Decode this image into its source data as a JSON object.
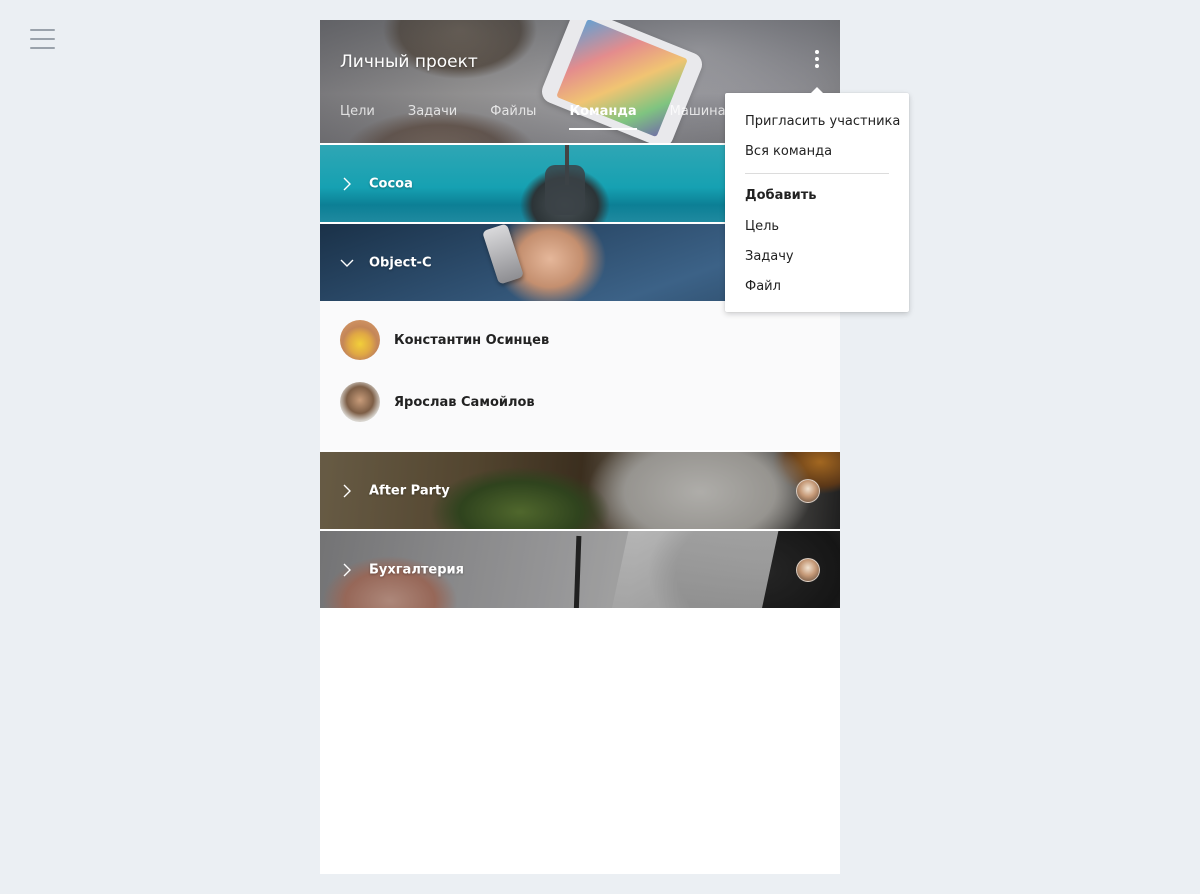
{
  "header": {
    "title": "Личный проект",
    "more_icon": "more-vertical-icon",
    "tabs": [
      {
        "label": "Цели",
        "active": false
      },
      {
        "label": "Задачи",
        "active": false
      },
      {
        "label": "Файлы",
        "active": false
      },
      {
        "label": "Команда",
        "active": true
      },
      {
        "label": "Машина времени",
        "active": false
      }
    ]
  },
  "nav": {
    "menu_icon": "hamburger-icon"
  },
  "teams": [
    {
      "name": "Cocoa",
      "expanded": false
    },
    {
      "name": "Object-C",
      "expanded": true
    },
    {
      "name": "After Party",
      "expanded": false
    },
    {
      "name": "Бухгалтерия",
      "expanded": false
    }
  ],
  "members": [
    {
      "name": "Константин Осинцев"
    },
    {
      "name": "Ярослав Самойлов"
    }
  ],
  "dropdown": {
    "items_top": [
      "Пригласить участника",
      "Вся команда"
    ],
    "add_heading": "Добавить",
    "items_add": [
      "Цель",
      "Задачу",
      "Файл"
    ]
  },
  "colors": {
    "page_bg": "#ebeff3",
    "card_bg": "#ffffff",
    "members_bg": "#fafafb",
    "text": "#222222",
    "hamburger": "#9aa2ab"
  }
}
